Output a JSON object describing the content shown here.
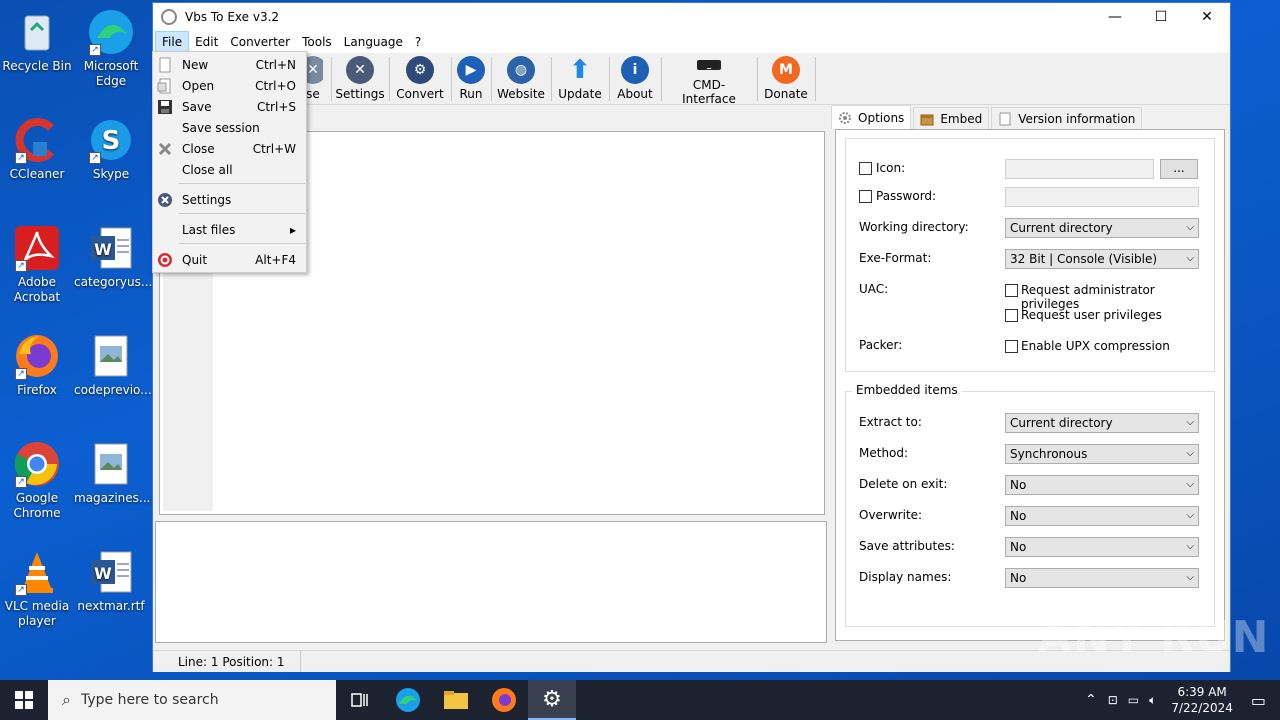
{
  "desktop": {
    "icons": [
      {
        "label": "Recycle Bin",
        "icon": "recycle-bin-icon"
      },
      {
        "label": "Microsoft Edge",
        "icon": "edge-icon"
      },
      {
        "label": "CCleaner",
        "icon": "ccleaner-icon"
      },
      {
        "label": "Skype",
        "icon": "skype-icon"
      },
      {
        "label": "Adobe Acrobat",
        "icon": "acrobat-icon"
      },
      {
        "label": "categoryus...",
        "icon": "word-doc-icon"
      },
      {
        "label": "Firefox",
        "icon": "firefox-icon"
      },
      {
        "label": "codeprevio...",
        "icon": "image-file-icon"
      },
      {
        "label": "Google Chrome",
        "icon": "chrome-icon"
      },
      {
        "label": "magazines...",
        "icon": "image-file-icon"
      },
      {
        "label": "VLC media player",
        "icon": "vlc-icon"
      },
      {
        "label": "nextmar.rtf",
        "icon": "word-doc-icon"
      }
    ]
  },
  "window": {
    "title": "Vbs To Exe v3.2",
    "controls": {
      "minimize": "—",
      "maximize": "☐",
      "close": "✕"
    },
    "menu": [
      "File",
      "Edit",
      "Converter",
      "Tools",
      "Language",
      "?"
    ],
    "toolbar": [
      {
        "label": "se",
        "icon": "close-file-icon"
      },
      {
        "label": "Settings",
        "icon": "settings-icon"
      },
      {
        "label": "Convert",
        "icon": "convert-gear-icon"
      },
      {
        "label": "Run",
        "icon": "run-play-icon"
      },
      {
        "label": "Website",
        "icon": "globe-icon"
      },
      {
        "label": "Update",
        "icon": "update-arrow-icon"
      },
      {
        "label": "About",
        "icon": "info-icon"
      },
      {
        "label": "CMD-Interface",
        "icon": "cmd-icon"
      },
      {
        "label": "Donate",
        "icon": "monero-icon"
      }
    ],
    "status": {
      "position": "Line: 1  Position: 1"
    }
  },
  "file_menu": {
    "items": [
      {
        "label": "New",
        "shortcut": "Ctrl+N",
        "icon": "new-file-icon"
      },
      {
        "label": "Open",
        "shortcut": "Ctrl+O",
        "icon": "open-file-icon"
      },
      {
        "label": "Save",
        "shortcut": "Ctrl+S",
        "icon": "save-disk-icon"
      },
      {
        "label": "Save session",
        "shortcut": "",
        "icon": ""
      },
      {
        "label": "Close",
        "shortcut": "Ctrl+W",
        "icon": "close-x-icon"
      },
      {
        "label": "Close all",
        "shortcut": "",
        "icon": ""
      },
      {
        "label": "Settings",
        "shortcut": "",
        "icon": "settings-icon"
      },
      {
        "label": "Last files",
        "shortcut": "▸",
        "icon": ""
      },
      {
        "label": "Quit",
        "shortcut": "Alt+F4",
        "icon": "quit-icon"
      }
    ]
  },
  "tabs": [
    {
      "label": "Options",
      "icon": "gear-icon"
    },
    {
      "label": "Embed",
      "icon": "package-icon"
    },
    {
      "label": "Version information",
      "icon": "document-icon"
    }
  ],
  "options": {
    "icon_label": "Icon:",
    "icon_browse": "...",
    "password_label": "Password:",
    "working_dir_label": "Working directory:",
    "working_dir_value": "Current directory",
    "exe_format_label": "Exe-Format:",
    "exe_format_value": "32 Bit | Console (Visible)",
    "uac_label": "UAC:",
    "uac_admin": "Request administrator privileges",
    "uac_user": "Request user privileges",
    "packer_label": "Packer:",
    "packer_upx": "Enable UPX compression"
  },
  "embedded": {
    "legend": "Embedded items",
    "rows": [
      {
        "label": "Extract to:",
        "value": "Current directory"
      },
      {
        "label": "Method:",
        "value": "Synchronous"
      },
      {
        "label": "Delete on exit:",
        "value": "No"
      },
      {
        "label": "Overwrite:",
        "value": "No"
      },
      {
        "label": "Save attributes:",
        "value": "No"
      },
      {
        "label": "Display names:",
        "value": "No"
      }
    ]
  },
  "taskbar": {
    "search_placeholder": "Type here to search",
    "time": "6:39 AM",
    "date": "7/22/2024"
  },
  "watermark": "ANY RUN"
}
